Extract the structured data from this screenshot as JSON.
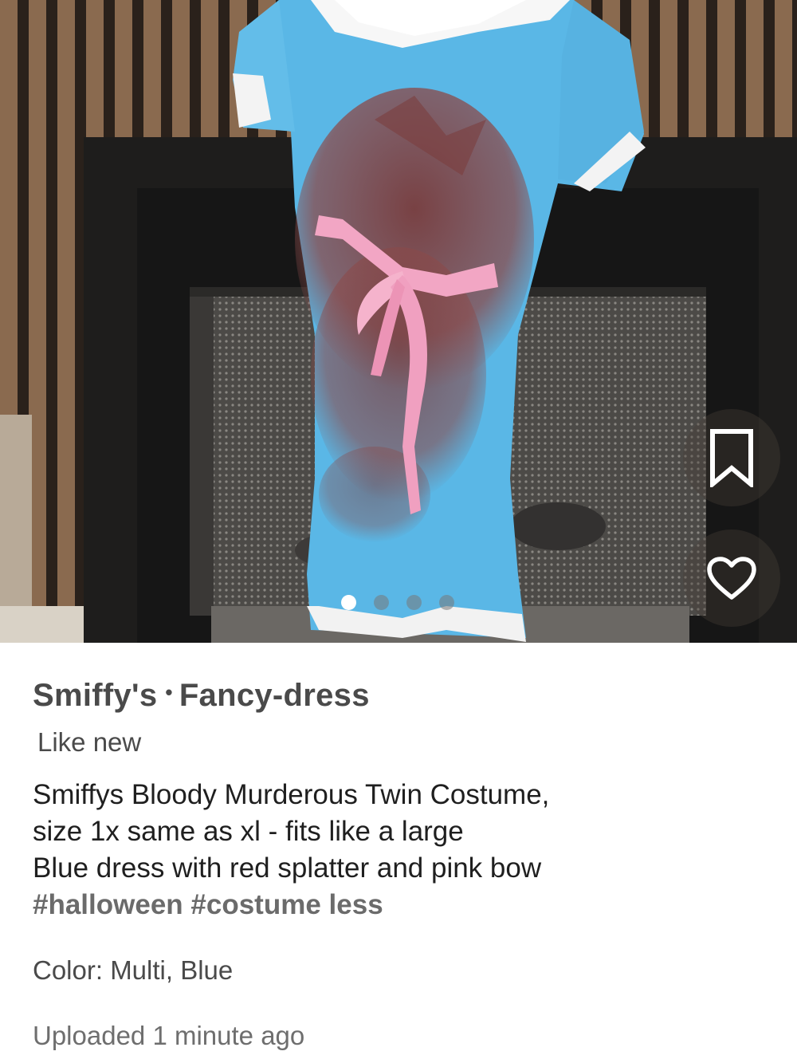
{
  "listing": {
    "brand": "Smiffy's",
    "separator": "•",
    "category": "Fancy-dress",
    "condition": "Like new",
    "description_lines": [
      "Smiffys Bloody Murderous Twin Costume,",
      "size 1x same as xl - fits like a large",
      "Blue dress with red splatter and pink bow"
    ],
    "hashtags": [
      "#halloween",
      "#costume"
    ],
    "less_label": "less",
    "color_line": "Color: Multi, Blue",
    "uploaded": "Uploaded 1 minute ago"
  },
  "gallery": {
    "total_images": 4,
    "active_index": 0,
    "icons": [
      "bookmark-icon",
      "heart-icon"
    ],
    "colors": {
      "dress": "#5ab7e6",
      "stain": "#8b4a4a",
      "bow": "#f2a6c4",
      "wall": "#7a5a42",
      "fireplace": "#1c1c1c"
    }
  }
}
